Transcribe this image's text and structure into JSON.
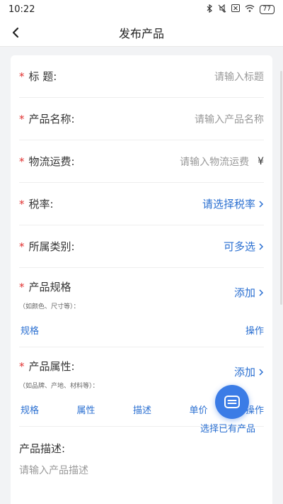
{
  "status": {
    "time": "10:22",
    "battery": "77"
  },
  "nav": {
    "title": "发布产品"
  },
  "form": {
    "title": {
      "label": "标 题:",
      "placeholder": "请输入标题"
    },
    "name": {
      "label": "产品名称:",
      "placeholder": "请输入产品名称"
    },
    "shipping": {
      "label": "物流运费:",
      "placeholder": "请输入物流运费",
      "suffix": "¥"
    },
    "tax": {
      "label": "税率:",
      "value": "请选择税率"
    },
    "category": {
      "label": "所属类别:",
      "value": "可多选"
    },
    "spec": {
      "label": "产品规格",
      "hint": "（如颜色、尺寸等）：",
      "add": "添加",
      "columns": [
        "规格",
        "操作"
      ]
    },
    "attr": {
      "label": "产品属性:",
      "hint": "（如品牌、产地、材料等）：",
      "add": "添加",
      "columns": [
        "规格",
        "属性",
        "描述",
        "单价",
        "操作"
      ]
    },
    "description": {
      "label": "产品描述:",
      "placeholder": "请输入产品描述"
    },
    "required_mark": "*"
  },
  "fab": {
    "label": "选择已有产品"
  },
  "colors": {
    "accent": "#2a6fd1",
    "required": "#e0302f",
    "fab": "#3b7ce6"
  }
}
